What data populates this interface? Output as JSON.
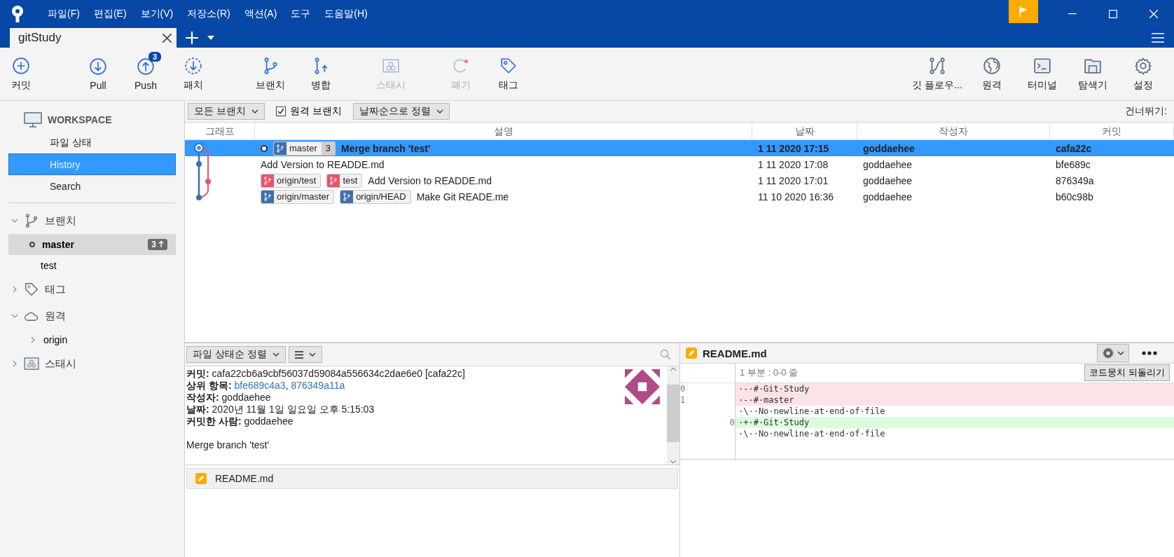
{
  "menu": [
    "파일(F)",
    "편집(E)",
    "보기(V)",
    "저장소(R)",
    "액션(A)",
    "도구",
    "도움말(H)"
  ],
  "tabs": [
    {
      "label": "gitStudy",
      "selected": true
    }
  ],
  "toolbar_left": [
    {
      "kind": "commit",
      "label": "커밋",
      "disabled": false
    },
    {
      "kind": "pull",
      "label": "Pull",
      "disabled": false
    },
    {
      "kind": "push",
      "label": "Push",
      "disabled": false,
      "badge": "3"
    },
    {
      "kind": "fetch",
      "label": "패치",
      "disabled": false
    },
    {
      "kind": "branch",
      "label": "브랜치",
      "disabled": false
    },
    {
      "kind": "merge",
      "label": "병합",
      "disabled": false
    },
    {
      "kind": "stash",
      "label": "스태시",
      "disabled": true
    },
    {
      "kind": "discard",
      "label": "폐기",
      "disabled": true
    },
    {
      "kind": "tag",
      "label": "태그",
      "disabled": false
    }
  ],
  "toolbar_right": [
    {
      "kind": "gitflow",
      "label": "깃 플로우..."
    },
    {
      "kind": "remote",
      "label": "원격"
    },
    {
      "kind": "terminal",
      "label": "터미널"
    },
    {
      "kind": "explorer",
      "label": "탐색기"
    },
    {
      "kind": "settings",
      "label": "설정"
    }
  ],
  "sidebar": {
    "workspace": "WORKSPACE",
    "items": [
      {
        "label": "파일 상태",
        "selected": false
      },
      {
        "label": "History",
        "selected": true
      },
      {
        "label": "Search",
        "selected": false
      }
    ],
    "sections": [
      {
        "kind": "branch",
        "title": "브랜치",
        "expanded": true,
        "children": [
          {
            "label": "master",
            "selected": true,
            "badge": "3"
          },
          {
            "label": "test",
            "selected": false
          }
        ]
      },
      {
        "kind": "tag",
        "title": "태그",
        "expanded": false
      },
      {
        "kind": "remote",
        "title": "원격",
        "expanded": true,
        "children": [
          {
            "label": "origin",
            "selected": false,
            "expanded": false
          }
        ]
      },
      {
        "kind": "stash",
        "title": "스태시",
        "expanded": false
      }
    ]
  },
  "filter_bar": {
    "branch_filter": "모든 브랜치",
    "remote_branches": {
      "label": "원격 브랜치",
      "checked": true
    },
    "sort": "날짜순으로 정렬",
    "jump_label": "건너뛰기:"
  },
  "commits": {
    "columns": [
      "그래프",
      "설명",
      "날짜",
      "작성자",
      "커밋"
    ],
    "rows": [
      {
        "selected": true,
        "head": true,
        "refs": [
          {
            "label": "master",
            "color": "#3d6fb0",
            "count": "3"
          }
        ],
        "message": "Merge branch 'test'",
        "date": "1 11 2020 17:15",
        "author": "goddaehee",
        "hash": "cafa22c"
      },
      {
        "selected": false,
        "head": false,
        "refs": [],
        "message": "Add Version to READDE.md",
        "date": "1 11 2020 17:08",
        "author": "goddaehee",
        "hash": "bfe689c"
      },
      {
        "selected": false,
        "head": false,
        "refs": [
          {
            "label": "origin/test",
            "color": "#e9546b"
          },
          {
            "label": "test",
            "color": "#e9546b"
          }
        ],
        "message": "Add Version to READDE.md",
        "date": "1 11 2020 17:01",
        "author": "goddaehee",
        "hash": "876349a"
      },
      {
        "selected": false,
        "head": false,
        "refs": [
          {
            "label": "origin/master",
            "color": "#3d6fb0"
          },
          {
            "label": "origin/HEAD",
            "color": "#3d6fb0"
          }
        ],
        "message": "Make Git READE.me",
        "date": "11 10 2020 16:36",
        "author": "goddaehee",
        "hash": "b60c98b"
      }
    ]
  },
  "details": {
    "sort": "파일 상태순 정렬",
    "lines": [
      {
        "label": "커밋:",
        "value": "cafa22cb6a9cbf56037d59084a556634c2dae6e0 [cafa22c]"
      },
      {
        "label": "상위 항목:",
        "links": [
          "bfe689c4a3",
          "876349a11a"
        ],
        "separator": ","
      },
      {
        "label": "작성자:",
        "value": "goddaehee"
      },
      {
        "label": "날짜:",
        "value": "2020년 11월 1일 일요일 오후 5:15:03"
      },
      {
        "label": "커밋한 사람:",
        "value": "goddaehee"
      }
    ],
    "message": "Merge branch 'test'",
    "files": [
      {
        "name": "README.md"
      }
    ]
  },
  "diff": {
    "file": "README.md",
    "hunk": "1 부분 : 0-0 줄",
    "revert": "코드뭉치 되돌리기",
    "lines": [
      {
        "kind": "removed",
        "old": "0",
        "text": "·-·#·Git·Study"
      },
      {
        "kind": "removed",
        "old": "1",
        "text": "·-·#·master"
      },
      {
        "kind": "context",
        "text": "·\\··No·newline·at·end·of·file"
      },
      {
        "kind": "added",
        "new": "0",
        "text": "·+·#·Git·Study"
      },
      {
        "kind": "context",
        "text": "·\\··No·newline·at·end·of·file"
      }
    ]
  }
}
